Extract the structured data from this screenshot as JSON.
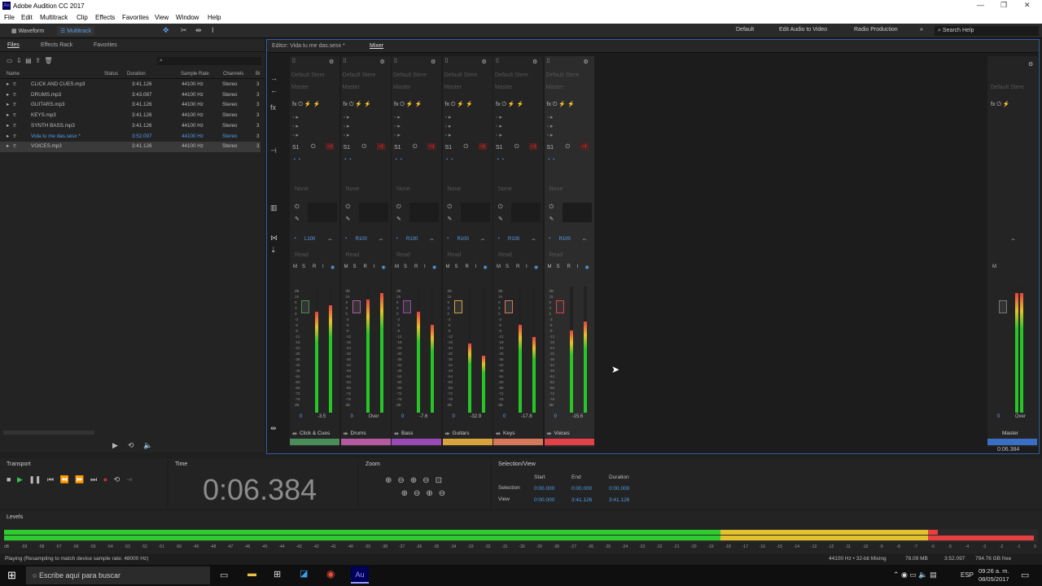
{
  "window": {
    "title": "Adobe Audition CC 2017",
    "logo": "Au"
  },
  "menu": [
    "File",
    "Edit",
    "Multitrack",
    "Clip",
    "Effects",
    "Favorites",
    "View",
    "Window",
    "Help"
  ],
  "toolbar": {
    "waveform": "Waveform",
    "multitrack": "Multitrack",
    "workspaces": [
      "Default",
      "Edit Audio to Video",
      "Radio Production"
    ],
    "search": "Search Help"
  },
  "files": {
    "tabs": [
      "Files",
      "Effects Rack",
      "Favorites"
    ],
    "columns": [
      "Name",
      "Status",
      "Duration",
      "Sample Rate",
      "Channels",
      "Bi"
    ],
    "rows": [
      {
        "name": "CLICK AND CUES.mp3",
        "duration": "3:41.126",
        "rate": "44100 Hz",
        "ch": "Stereo",
        "bi": "3"
      },
      {
        "name": "DRUMS.mp3",
        "duration": "3:43.087",
        "rate": "44100 Hz",
        "ch": "Stereo",
        "bi": "3"
      },
      {
        "name": "GUITARS.mp3",
        "duration": "3:41.126",
        "rate": "44100 Hz",
        "ch": "Stereo",
        "bi": "3"
      },
      {
        "name": "KEYS.mp3",
        "duration": "3:41.126",
        "rate": "44100 Hz",
        "ch": "Stereo",
        "bi": "3"
      },
      {
        "name": "SYNTH BASS.mp3",
        "duration": "3:41.126",
        "rate": "44100 Hz",
        "ch": "Stereo",
        "bi": "3"
      },
      {
        "name": "Vida tu me das.sesx *",
        "duration": "3:52.097",
        "rate": "44100 Hz",
        "ch": "Stereo",
        "bi": "3"
      },
      {
        "name": "VOICES.mp3",
        "duration": "3:41.126",
        "rate": "44100 Hz",
        "ch": "Stereo",
        "bi": "3"
      }
    ]
  },
  "mixer": {
    "editor_tab": "Editor: Vida tu me das.sesx *",
    "mixer_tab": "Mixer",
    "preset": "Default Stere",
    "master_label": "Master",
    "send": "S1",
    "none": "None",
    "read": "Read",
    "dbscale": [
      "dB",
      "15",
      "9",
      "3",
      "0",
      "-3",
      "-6",
      "-9",
      "-12",
      "-18",
      "-24",
      "-30",
      "-36",
      "-42",
      "-48",
      "-54",
      "-60",
      "-66",
      "-72",
      "-78",
      "dB"
    ],
    "channels": [
      {
        "name": "Click & Cues",
        "pan": "L100",
        "vol": "-3.5",
        "color": "#4a8c5a",
        "lvl": 0.85,
        "lvl2": 0.8
      },
      {
        "name": "Drums",
        "pan": "R100",
        "vol": "Over",
        "color": "#b45aa0",
        "lvl": 0.95,
        "lvl2": 0.9
      },
      {
        "name": "Bass",
        "pan": "R100",
        "vol": "-7.6",
        "color": "#9a4ab4",
        "lvl": 0.7,
        "lvl2": 0.8
      },
      {
        "name": "Guitars",
        "pan": "R100",
        "vol": "-32.9",
        "color": "#d8a23c",
        "lvl": 0.45,
        "lvl2": 0.55
      },
      {
        "name": "Keys",
        "pan": "R100",
        "vol": "-17.8",
        "color": "#d8785a",
        "lvl": 0.6,
        "lvl2": 0.7
      },
      {
        "name": "Voices",
        "pan": "R100",
        "vol": "-15.6",
        "color": "#e4404a",
        "lvl": 0.72,
        "lvl2": 0.65
      }
    ],
    "master": {
      "name": "Master",
      "vol": "Over",
      "time": "0:06.384"
    }
  },
  "transport": {
    "title": "Transport"
  },
  "time": {
    "title": "Time",
    "value": "0:06.384"
  },
  "zoom": {
    "title": "Zoom"
  },
  "selection": {
    "title": "Selection/View",
    "cols": [
      "Start",
      "End",
      "Duration"
    ],
    "selection": [
      "0:00.000",
      "0:00.000",
      "0:00.000"
    ],
    "view": [
      "0:00.000",
      "3:41.126",
      "3:41.126"
    ],
    "row_labels": [
      "Selection",
      "View"
    ]
  },
  "levels": {
    "title": "Levels",
    "scale": [
      "dB",
      "-59",
      "-58",
      "-57",
      "-56",
      "-55",
      "-54",
      "-53",
      "-52",
      "-51",
      "-50",
      "-49",
      "-48",
      "-47",
      "-46",
      "-45",
      "-44",
      "-43",
      "-42",
      "-41",
      "-40",
      "-39",
      "-38",
      "-37",
      "-36",
      "-35",
      "-34",
      "-33",
      "-32",
      "-31",
      "-30",
      "-29",
      "-28",
      "-27",
      "-26",
      "-25",
      "-24",
      "-23",
      "-22",
      "-21",
      "-20",
      "-19",
      "-18",
      "-17",
      "-16",
      "-15",
      "-14",
      "-13",
      "-12",
      "-11",
      "-10",
      "-9",
      "-8",
      "-7",
      "-6",
      "-5",
      "-4",
      "-3",
      "-2",
      "-1",
      "0"
    ]
  },
  "status": {
    "left": "Playing (Resampling to match device sample rate: 48000 Hz)",
    "format": "44100 Hz • 32-bit Mixing",
    "mem": "78.09 MB",
    "dur": "3:52.097",
    "free": "794.76 GB free"
  },
  "taskbar": {
    "search": "Escribe aquí para buscar",
    "lang": "ESP",
    "time": "09:26 a. m.",
    "date": "08/05/2017"
  }
}
